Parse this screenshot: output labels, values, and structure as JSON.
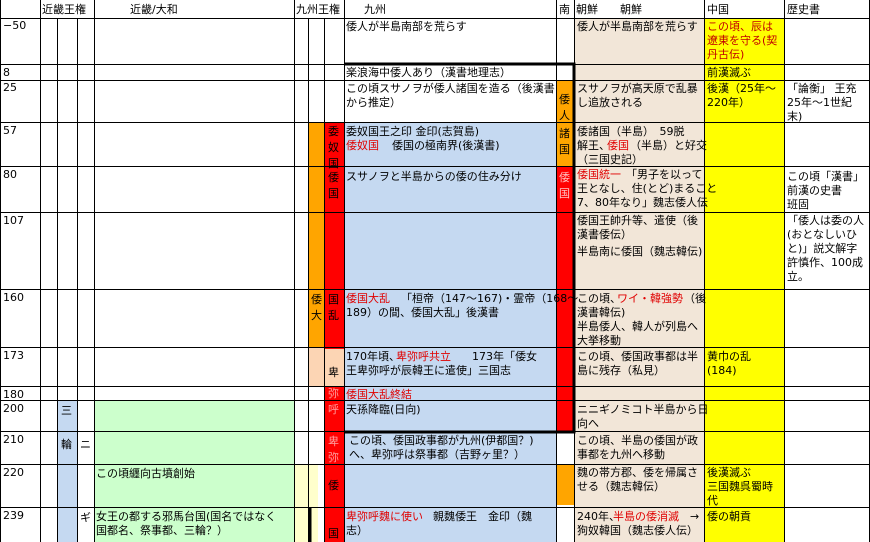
{
  "headers": {
    "kinki_king": "近畿王権",
    "kinki_yamato": "近畿/大和",
    "kyushu_king": "九州王権",
    "kyushu": "九州",
    "south": "南",
    "korea1": "朝鮮",
    "korea2": "朝鮮",
    "china": "中国",
    "history": "歴史書"
  },
  "colors": {
    "light_blue": "#c5d9f1",
    "orange": "#ffa500",
    "red": "#ff0000",
    "yellow": "#ffff00",
    "light_green": "#ccffcc",
    "beige": "#f2e6d8",
    "pale_yellow": "#ffffcc",
    "text_red": "#e00000"
  },
  "years": [
    "−50",
    "8",
    "25",
    "57",
    "80",
    "107",
    "160",
    "173",
    "180",
    "200",
    "210",
    "220",
    "239"
  ],
  "kinki_col": {
    "mi": "三",
    "wa": "輪",
    "ni": "ニ",
    "gi": "ギ"
  },
  "yamato": {
    "r220": "この頃纒向古墳創始",
    "r239a": "女王の都する邪馬台国(国名ではなく",
    "r239b": "国都名、祭事都、三輪？）"
  },
  "kyushu_vertical": {
    "wanakoku": "委奴国",
    "wakoku": "倭国",
    "wadai": "倭大",
    "kokuran": "国乱",
    "himi": "卑",
    "himiko": "弥呼",
    "himiko2": "卑弥",
    "wa239": "倭",
    "koku239": "国"
  },
  "kyushu_text": {
    "r_50": "倭人が半島南部を荒らす",
    "r8": "楽浪海中倭人あり（漢書地理志）",
    "r25a": "この頃スサノヲが倭人諸国を造る（後漢書",
    "r25b": "から推定）",
    "r57a": "委奴国王之印 金印(志賀島)",
    "r57b_red": "倭奴国",
    "r57b": "倭国の極南界(後漢書)",
    "r80": "スサノヲと半島からの倭の住み分け",
    "r160a_red": "倭国大乱",
    "r160a": "「桓帝（147～167)・霊帝（168～",
    "r160b": "189）の間、倭国大乱」後漢書",
    "r173a": "170年頃、",
    "r173a_red": "卑弥呼共立",
    "r173a2": "173年「倭女",
    "r173b": "王卑弥呼が辰韓王に遣使」三国志",
    "r180_red": "倭国大乱終結",
    "r200": "天孫降臨(日向)",
    "r210a": "この頃、倭国政事都が九州(伊都国？)",
    "r210b": "へ、卑弥呼は祭事都（吉野ヶ里？）",
    "r239a_red": "卑弥呼魏に使い",
    "r239a": "親魏倭王　金印（魏",
    "r239b": "志）"
  },
  "south_vertical": {
    "wa": "倭",
    "jin": "人",
    "sho": "諸",
    "koku": "国",
    "wakoku": "倭国"
  },
  "korea_text": {
    "r_50": "倭人が半島南部を荒らす",
    "r25a": "スサノヲが高天原で乱暴",
    "r25b": "し追放される",
    "r57a": "倭諸国（半島）　59脱",
    "r57b_pre": "解王、",
    "r57b_red": "倭国",
    "r57b": "（半島）と好交",
    "r57c": "（三国史記）",
    "r80a_red": "倭国統一",
    "r80a": "「男子を以って",
    "r80b": "王となし、住(とど)まること",
    "r80c": "7、80年なり」魏志倭人伝",
    "r107a": "倭国王帥升等、遣使（後",
    "r107b": "漢書倭伝）",
    "r107c": "半島南に倭国（魏志韓伝)",
    "r160a": "この頃、",
    "r160a_red": "ワイ・韓強勢",
    "r160a2": "（後",
    "r160b": "漢書韓伝)",
    "r160c": "半島倭人、韓人が列島へ",
    "r160d": "大挙移動",
    "r173a": "この頃、倭国政事都は半",
    "r173b": "島に残存（私見）",
    "r200a": "ニニギノミコト半島から日",
    "r200b": "向へ",
    "r210a": "この頃、半島の倭国が政",
    "r210b": "事都を九州へ移動",
    "r220a": "魏の帯方郡、倭を帰属さ",
    "r220b": "せる（魏志韓伝）",
    "r239a": "240年、",
    "r239a_red": "半島の倭消滅",
    "r239a2": "→",
    "r239b": "狗奴韓国（魏志倭人伝）"
  },
  "china_text": {
    "r_50a": "この頃、辰は",
    "r_50b": "遼東を守る(契",
    "r_50c": "丹古伝)",
    "r8": "前漢滅ぶ",
    "r25a": "後漢（25年～",
    "r25b": "220年）",
    "r173a": "黄巾の乱",
    "r173b": "(184)",
    "r220a": "後漢滅ぶ",
    "r220b": "三国魏呉蜀時",
    "r220c": "代",
    "r239": "倭の朝貢"
  },
  "history_text": {
    "r25a": "「論衡」 王充",
    "r25b": "25年～1世紀",
    "r25c": "末)",
    "r80a": "この頃「漢書」",
    "r80b": "前漢の史書",
    "r80c": "班固",
    "r107a": "「倭人は委の人",
    "r107b": "(おとなしいひ",
    "r107c": "と)」説文解字",
    "r107d": "許慎作、100成",
    "r107e": "立。"
  }
}
